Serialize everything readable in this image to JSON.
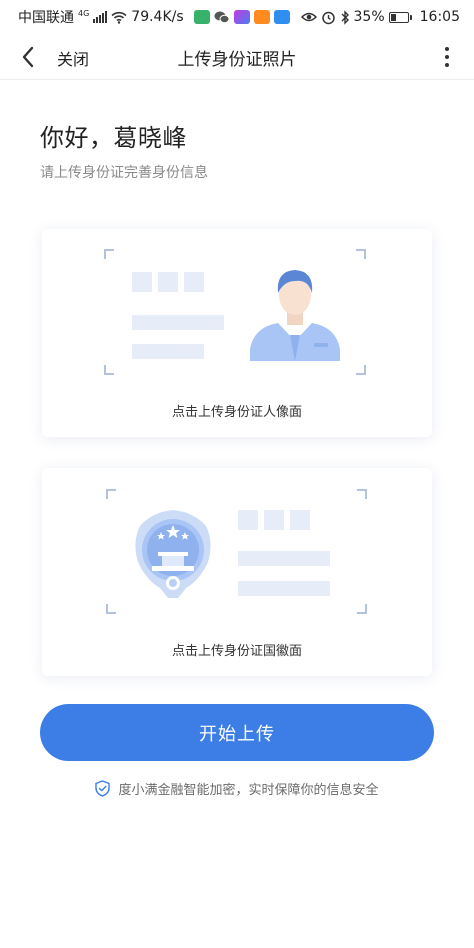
{
  "status_bar": {
    "carrier": "中国联通",
    "network": "4G",
    "speed": "79.4K/s",
    "battery": "35%",
    "battery_level": 0.35,
    "time": "16:05",
    "icons": [
      "signal-icon",
      "wifi-icon",
      "app-icon",
      "wechat-icon",
      "app-icon",
      "app-icon",
      "app-icon",
      "eye-icon",
      "alarm-icon",
      "bluetooth-icon",
      "battery-icon"
    ]
  },
  "nav": {
    "back_icon": "chevron-left-icon",
    "close_label": "关闭",
    "title": "上传身份证照片",
    "more_icon": "more-vertical-icon"
  },
  "greeting": {
    "title": "你好，葛晓峰",
    "subtitle": "请上传身份证完善身份信息"
  },
  "cards": {
    "front_label": "点击上传身份证人像面",
    "back_label": "点击上传身份证国徽面"
  },
  "actions": {
    "start_label": "开始上传"
  },
  "security": {
    "icon": "shield-check-icon",
    "text": "度小满金融智能加密，实时保障你的信息安全"
  },
  "colors": {
    "primary": "#3d7ee6",
    "placeholder": "#e6edf9",
    "frame": "#b4c3dd"
  }
}
